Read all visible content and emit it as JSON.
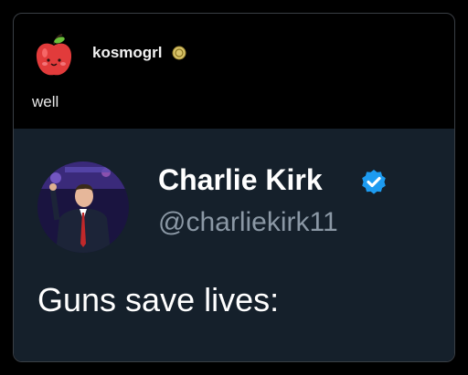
{
  "post": {
    "username": "kosmogrl",
    "avatar_icon": "apple-icon",
    "badge_icon": "coin-badge-icon",
    "text": "well"
  },
  "embedded_tweet": {
    "display_name": "Charlie Kirk",
    "handle": "@charliekirk11",
    "verified_icon": "verified-check-icon",
    "text": "Guns save lives:"
  },
  "colors": {
    "page_background": "#000000",
    "embed_background": "#15202b",
    "verified_blue": "#1d9bf0",
    "handle_gray": "#8b98a5"
  }
}
